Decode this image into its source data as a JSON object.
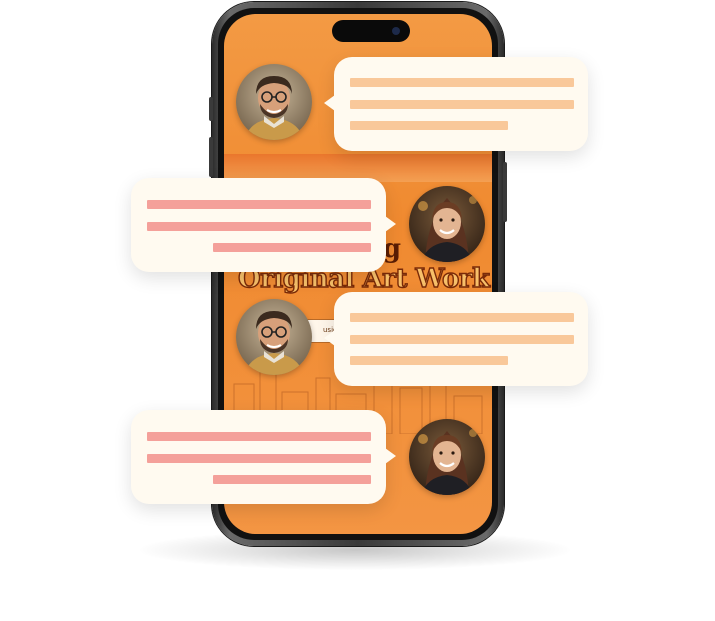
{
  "screen": {
    "headline": "Original Art Work",
    "partial_word": "ng",
    "search_hint": "usic"
  },
  "colors": {
    "screen_orange": "#f08a30",
    "bubble_bg": "#fffaf0",
    "line_peach": "#f9c89a",
    "line_pink": "#f4a09a"
  },
  "chat": [
    {
      "sender": "man-avatar",
      "side": "right"
    },
    {
      "sender": "woman-avatar",
      "side": "left"
    },
    {
      "sender": "man-avatar",
      "side": "right"
    },
    {
      "sender": "woman-avatar",
      "side": "left"
    }
  ]
}
